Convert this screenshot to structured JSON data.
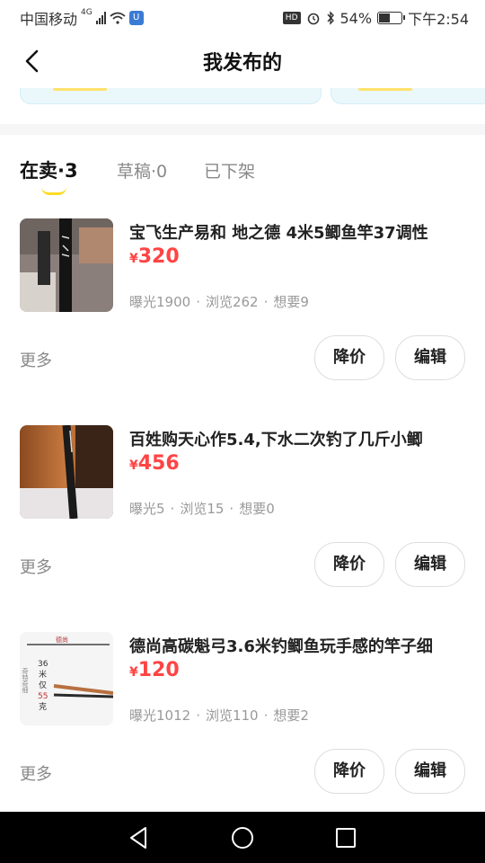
{
  "status_bar": {
    "carrier": "中国移动",
    "network": "4G",
    "battery_percent": "54%",
    "battery_level": 0.54,
    "time": "下午2:54"
  },
  "header": {
    "title": "我发布的"
  },
  "tabs": [
    {
      "label": "在卖·3",
      "active": true
    },
    {
      "label": "草稿·0",
      "active": false
    },
    {
      "label": "已下架",
      "active": false
    }
  ],
  "items": [
    {
      "title": "宝飞生产易和 地之德 4米5鲫鱼竿37调性",
      "currency": "¥",
      "price": "320",
      "exposure": "曝光1900",
      "views": "浏览262",
      "wants": "想要9",
      "more_label": "更多",
      "price_cut_label": "降价",
      "edit_label": "编辑"
    },
    {
      "title": "百姓购天心作5.4,下水二次钓了几斤小鲫",
      "currency": "¥",
      "price": "456",
      "exposure": "曝光5",
      "views": "浏览15",
      "wants": "想要0",
      "more_label": "更多",
      "price_cut_label": "降价",
      "edit_label": "编辑"
    },
    {
      "title": "德尚高碳魁弓3.6米钓鲫鱼玩手感的竿子细",
      "currency": "¥",
      "price": "120",
      "exposure": "曝光1012",
      "views": "浏览110",
      "wants": "想要2",
      "more_label": "更多",
      "price_cut_label": "降价",
      "edit_label": "编辑",
      "thumb_text": {
        "brand": "德尚",
        "line1": "36",
        "line2": "米",
        "line3": "仅",
        "line4": "55",
        "line5": "克",
        "side": "奇特奇细"
      }
    }
  ],
  "colors": {
    "accent_yellow": "#ffdb26",
    "price_red": "#ff4444"
  }
}
